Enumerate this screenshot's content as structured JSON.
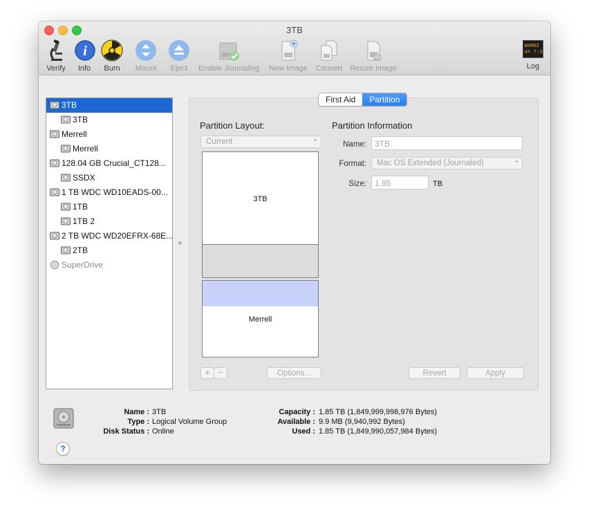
{
  "window": {
    "title": "3TB"
  },
  "toolbar": {
    "items": [
      {
        "label": "Verify",
        "icon": "microscope-icon",
        "enabled": true
      },
      {
        "label": "Info",
        "icon": "info-icon",
        "enabled": true
      },
      {
        "label": "Burn",
        "icon": "radiation-icon",
        "enabled": true
      },
      {
        "label": "Mount",
        "icon": "mount-icon",
        "enabled": false
      },
      {
        "label": "Eject",
        "icon": "eject-icon",
        "enabled": false
      },
      {
        "label": "Enable Journaling",
        "icon": "journaling-icon",
        "enabled": false
      },
      {
        "label": "New Image",
        "icon": "new-image-icon",
        "enabled": false
      },
      {
        "label": "Convert",
        "icon": "convert-icon",
        "enabled": false
      },
      {
        "label": "Resize Image",
        "icon": "resize-image-icon",
        "enabled": false
      }
    ],
    "log": {
      "label": "Log",
      "icon_text": "WARNI\nAY 7:36"
    }
  },
  "sidebar": {
    "items": [
      {
        "label": "3TB",
        "depth": 0,
        "selected": true
      },
      {
        "label": "3TB",
        "depth": 1
      },
      {
        "label": "Merrell",
        "depth": 0
      },
      {
        "label": "Merrell",
        "depth": 1
      },
      {
        "label": "128.04 GB Crucial_CT128...",
        "depth": 0
      },
      {
        "label": "SSDX",
        "depth": 1
      },
      {
        "label": "1 TB WDC WD10EADS-00...",
        "depth": 0
      },
      {
        "label": "1TB",
        "depth": 1
      },
      {
        "label": "1TB 2",
        "depth": 1
      },
      {
        "label": "2 TB WDC WD20EFRX-68E...",
        "depth": 0
      },
      {
        "label": "2TB",
        "depth": 1
      },
      {
        "label": "SuperDrive",
        "depth": 0,
        "type": "optical"
      }
    ]
  },
  "tabs": [
    {
      "label": "First Aid",
      "active": false
    },
    {
      "label": "Partition",
      "active": true
    }
  ],
  "partition_layout": {
    "title": "Partition Layout:",
    "popup_value": "Current",
    "partitions": [
      {
        "label": "3TB"
      },
      {
        "label": "Merrell"
      }
    ],
    "add_label": "+",
    "remove_label": "−",
    "options_label": "Options..."
  },
  "partition_info": {
    "title": "Partition Information",
    "name_label": "Name:",
    "name_value": "3TB",
    "format_label": "Format:",
    "format_value": "Mac OS Extended (Journaled)",
    "size_label": "Size:",
    "size_value": "1.85",
    "size_unit": "TB",
    "revert_label": "Revert",
    "apply_label": "Apply"
  },
  "disk_info": {
    "name_key": "Name :",
    "name_value": "3TB",
    "type_key": "Type :",
    "type_value": "Logical Volume Group",
    "status_key": "Disk Status :",
    "status_value": "Online",
    "capacity_key": "Capacity :",
    "capacity_value": "1.85 TB (1,849,999,998,976 Bytes)",
    "available_key": "Available :",
    "available_value": "9.9 MB (9,940,992 Bytes)",
    "used_key": "Used :",
    "used_value": "1.85 TB (1,849,990,057,984 Bytes)"
  },
  "help": {
    "label": "?"
  },
  "colors": {
    "selection": "#1e68d6",
    "segment_active": "#2a7fef",
    "free_space": "#c8d2fb"
  }
}
